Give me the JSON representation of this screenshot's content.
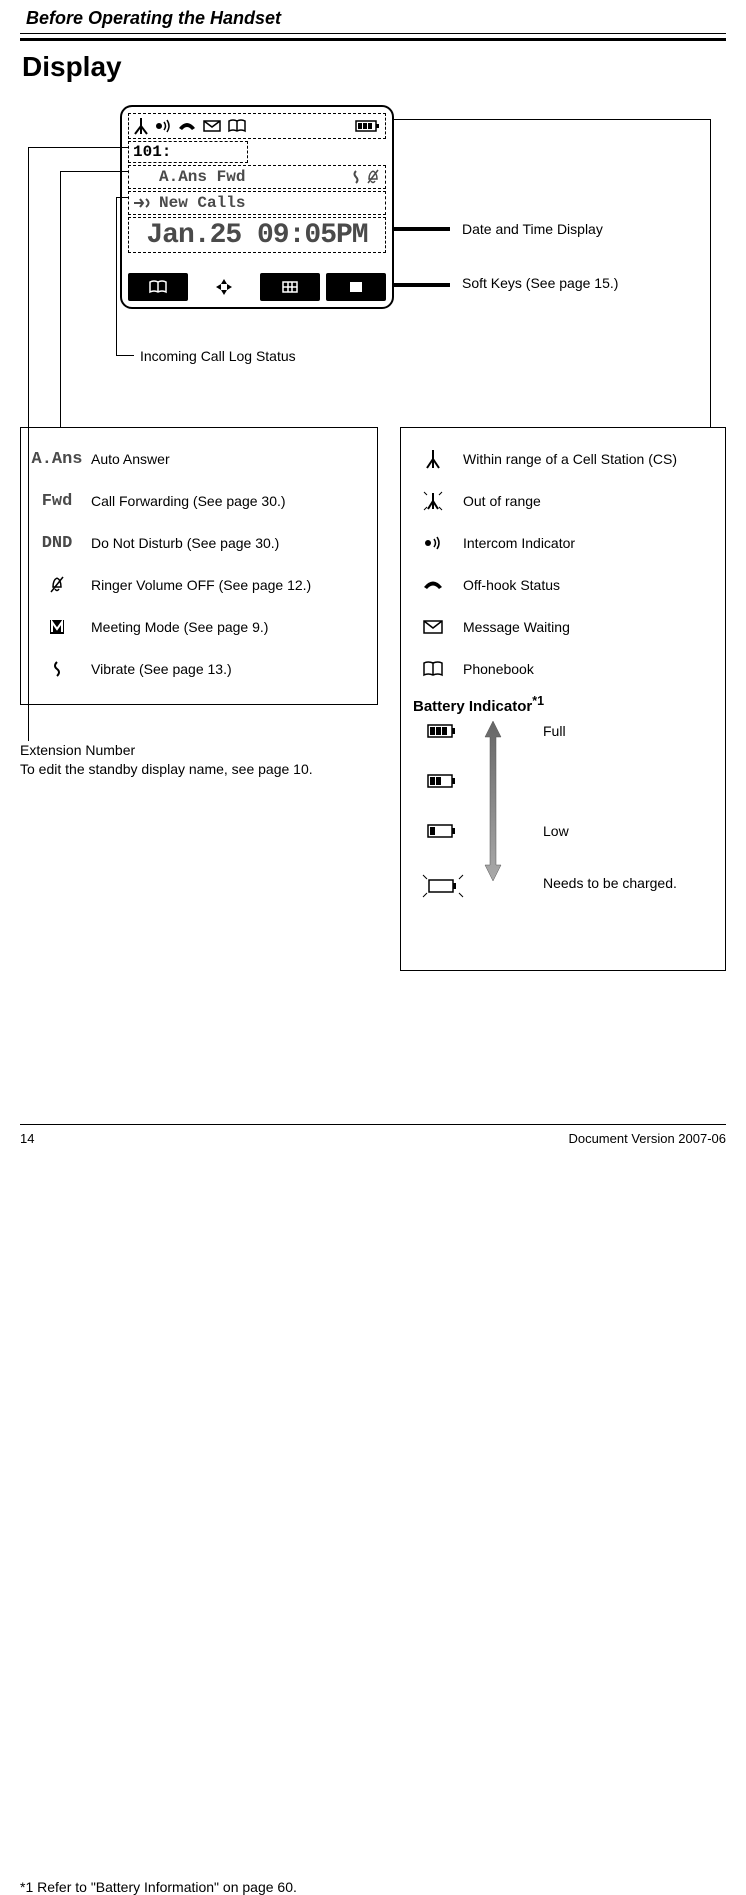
{
  "header": {
    "chapter": "Before Operating the Handset",
    "section": "Display"
  },
  "phone": {
    "extension": "101:",
    "mode_line": "A.Ans Fwd",
    "calls_line": "New Calls",
    "datetime": "Jan.25 09:05PM"
  },
  "callouts": {
    "datetime": "Date and Time Display",
    "softkeys": "Soft Keys (See page 15.)",
    "incoming": "Incoming Call Log Status"
  },
  "legend_left": {
    "aans": {
      "icon": "A.Ans",
      "label": "Auto Answer"
    },
    "fwd": {
      "icon": "Fwd",
      "label": "Call Forwarding (See page 30.)"
    },
    "dnd": {
      "icon": "DND",
      "label": "Do Not Disturb (See page 30.)"
    },
    "ringer": {
      "label": "Ringer Volume OFF (See page 12.)"
    },
    "meeting": {
      "label": "Meeting Mode (See page 9.)"
    },
    "vibrate": {
      "label": "Vibrate (See page 13.)"
    }
  },
  "legend_right": {
    "in_range": "Within range of a Cell Station (CS)",
    "out_range": "Out of range",
    "intercom": "Intercom Indicator",
    "offhook": "Off-hook Status",
    "msg": "Message Waiting",
    "phonebook": "Phonebook",
    "battery_title": "Battery Indicator",
    "battery_sup": "*1",
    "full": "Full",
    "low": "Low",
    "needs": "Needs to be charged."
  },
  "ext_note": {
    "line1": "Extension Number",
    "line2": "To edit the standby display name, see page 10."
  },
  "footnote": "*1   Refer to \"Battery Information\" on page 60.",
  "footer": {
    "page": "14",
    "version": "Document Version 2007-06"
  }
}
